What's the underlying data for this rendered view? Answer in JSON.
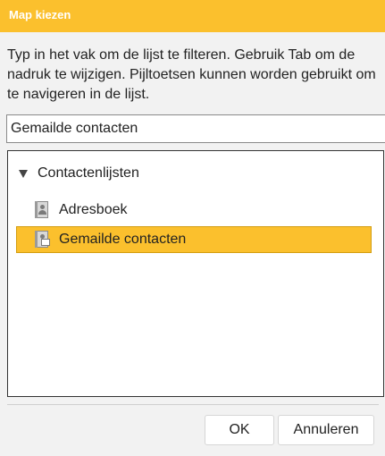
{
  "dialog": {
    "title": "Map kiezen",
    "instructions": "Typ in het vak om de lijst te filteren. Gebruik Tab om de nadruk te wijzigen. Pijltoetsen kunnen worden gebruikt om te navigeren in de lijst.",
    "filter_value": "Gemailde contacten"
  },
  "tree": {
    "root": {
      "label": "Contactenlijsten",
      "icon": "triangle-down-icon",
      "expanded": true
    },
    "items": [
      {
        "label": "Adresboek",
        "icon": "address-book-icon",
        "selected": false
      },
      {
        "label": "Gemailde contacten",
        "icon": "emailed-contacts-icon",
        "selected": true
      }
    ]
  },
  "buttons": {
    "ok_label": "OK",
    "cancel_label": "Annuleren"
  },
  "colors": {
    "accent": "#fbc02d",
    "selection_border": "#d39e12",
    "background": "#f2f2f2"
  }
}
